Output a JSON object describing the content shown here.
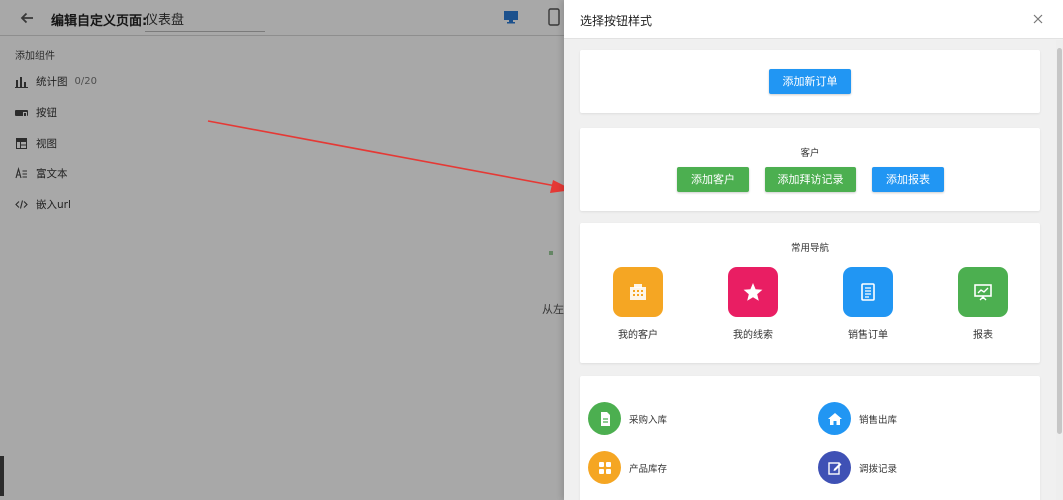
{
  "editor": {
    "title": "编辑自定义页面:",
    "page_name": "仪表盘",
    "canvas_hint": "从左"
  },
  "sidebar": {
    "title": "添加组件",
    "items": [
      {
        "label": "统计图",
        "count": "0/20",
        "icon": "bar-chart-icon"
      },
      {
        "label": "按钮",
        "icon": "button-icon"
      },
      {
        "label": "视图",
        "icon": "table-view-icon"
      },
      {
        "label": "富文本",
        "icon": "rich-text-icon"
      },
      {
        "label": "嵌入url",
        "icon": "code-icon"
      }
    ]
  },
  "drawer": {
    "title": "选择按钮样式",
    "card1": {
      "button": "添加新订单"
    },
    "card2": {
      "label": "客户",
      "buttons": [
        {
          "label": "添加客户",
          "color": "#4caf50"
        },
        {
          "label": "添加拜访记录",
          "color": "#4caf50"
        },
        {
          "label": "添加报表",
          "color": "#2196f3"
        }
      ]
    },
    "card3": {
      "label": "常用导航",
      "items": [
        {
          "label": "我的客户",
          "color": "#f5a623",
          "icon": "building-icon"
        },
        {
          "label": "我的线索",
          "color": "#e91e63",
          "icon": "star-icon"
        },
        {
          "label": "销售订单",
          "color": "#2196f3",
          "icon": "document-icon"
        },
        {
          "label": "报表",
          "color": "#4caf50",
          "icon": "presentation-chart-icon"
        }
      ]
    },
    "card4": {
      "items": [
        {
          "label": "采购入库",
          "color": "#4caf50",
          "icon": "file-icon"
        },
        {
          "label": "销售出库",
          "color": "#2196f3",
          "icon": "home-icon"
        },
        {
          "label": "产品库存",
          "color": "#f5a623",
          "icon": "grid-icon"
        },
        {
          "label": "调拨记录",
          "color": "#3f51b5",
          "icon": "edit-icon"
        }
      ]
    }
  },
  "colors": {
    "primary_blue": "#2196f3",
    "green": "#4caf50",
    "arrow_red": "#e53935"
  }
}
